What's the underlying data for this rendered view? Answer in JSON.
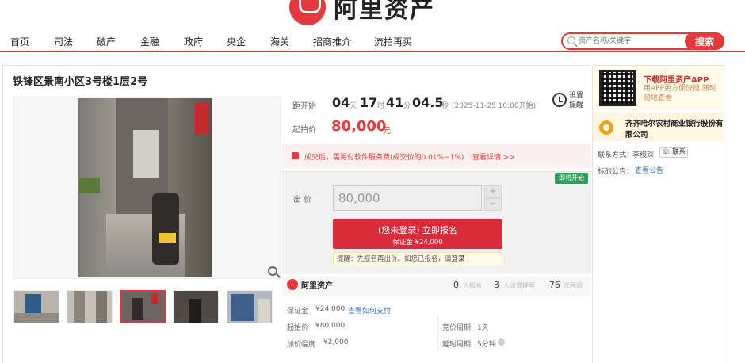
{
  "brand": {
    "logo_text": "阿里资产",
    "accent": "#e4393c"
  },
  "nav": {
    "items": [
      "首页",
      "司法",
      "破产",
      "金融",
      "政府",
      "央企",
      "海关",
      "招商推介",
      "流拍再买"
    ]
  },
  "search": {
    "placeholder": "资产名称/关键字",
    "button": "搜索"
  },
  "lot": {
    "title": "铁锋区景南小区3号楼1层2号",
    "countdown_label": "距开始",
    "days": "04",
    "days_unit": "天",
    "hours": "17",
    "hours_unit": "时",
    "minutes": "41",
    "minutes_unit": "分",
    "seconds": "04.5",
    "seconds_unit": "秒",
    "start_date": "(2025-11-25 10:00开始)",
    "reminder": "设置提醒",
    "start_price_label": "起拍价",
    "start_price": "80,000",
    "price_unit": "元",
    "notice": "成交后，需另付软件服务费(成交价的0.01%~1%)",
    "notice_link": "查看详情 >>",
    "status_badge": "即将开始",
    "bid_label": "出 价",
    "bid_value": "80,000",
    "step_up": "+",
    "step_down": "−",
    "register_main": "(您未登录) 立即报名",
    "register_sub": "保证金 ¥24,000",
    "tip_text": "提醒：先报名再出价。如您已报名，请",
    "tip_link": "登录"
  },
  "stats": {
    "brand_name": "阿里资产",
    "applicants": "0",
    "applicants_label": "人报名",
    "reminders": "3",
    "reminders_label": "人设置提醒",
    "views": "76",
    "views_label": "次围观"
  },
  "details": {
    "deposit_label": "保证金",
    "deposit": "¥24,000",
    "deposit_link": "查看如何支付",
    "start_label": "起始价",
    "start": "¥80,000",
    "increment_label": "加价幅度",
    "increment": "¥2,000",
    "cycle_label": "竞价周期",
    "cycle": "1天",
    "delay_label": "延时周期",
    "delay": "5分钟"
  },
  "side": {
    "app_title": "下载阿里资产APP",
    "app_desc": "用APP更方便快捷 随时随地查看",
    "bank_name": "齐齐哈尔农村商业银行股份有限公司",
    "contact_label": "联系方式：",
    "contact_name": "李稷琛",
    "contact_btn": "联系",
    "notice_label": "标的公告：",
    "notice_link": "查看公告"
  }
}
